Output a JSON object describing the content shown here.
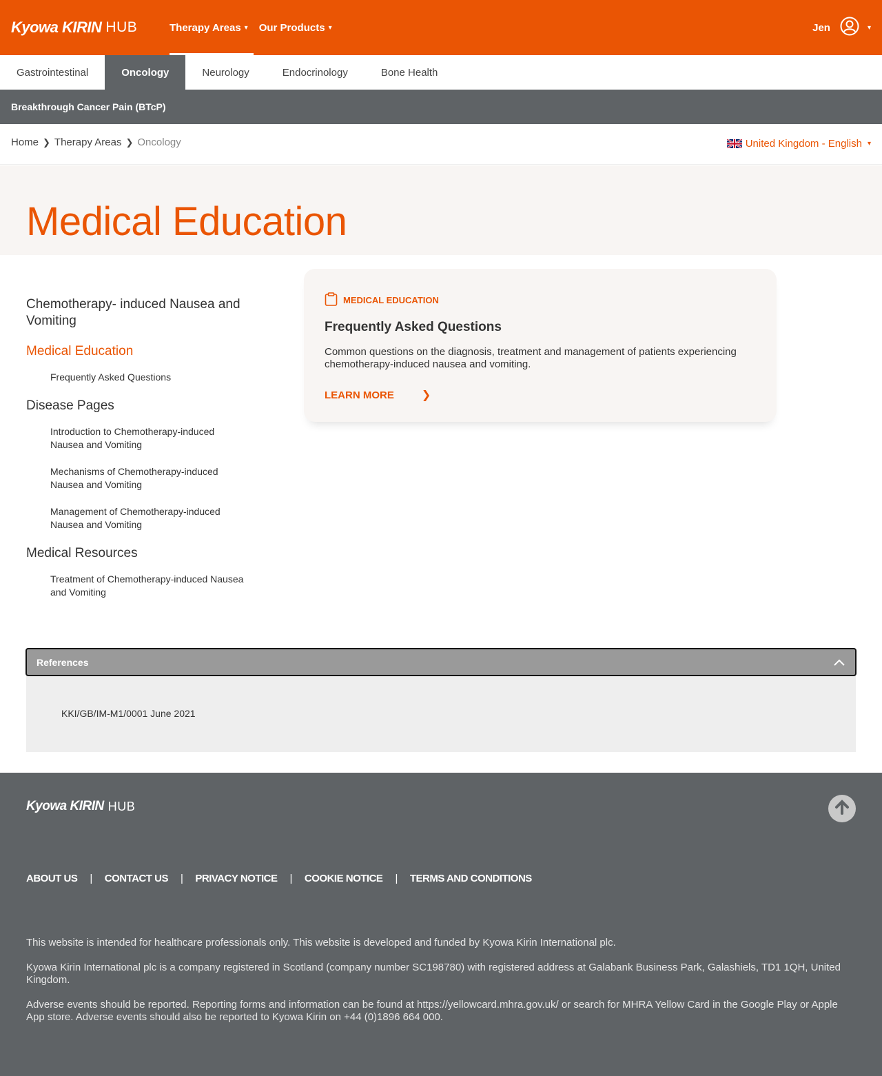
{
  "header": {
    "logo_mark": "Kyowa KIRIN",
    "logo_hub": "HUB",
    "nav": [
      {
        "label": "Therapy Areas",
        "caret": "▾"
      },
      {
        "label": "Our Products",
        "caret": "▾"
      }
    ],
    "user_name": "Jen",
    "user_caret": "▾"
  },
  "tabs": [
    "Gastrointestinal",
    "Oncology",
    "Neurology",
    "Endocrinology",
    "Bone Health"
  ],
  "subbar": {
    "label": "Breakthrough Cancer Pain (BTcP)"
  },
  "breadcrumb": {
    "items": [
      "Home",
      "Therapy Areas",
      "Oncology"
    ],
    "sep": "❯"
  },
  "language": {
    "label": "United Kingdom - English",
    "caret": "▾"
  },
  "hero": {
    "title": "Medical Education"
  },
  "sidebar": {
    "sections": [
      {
        "heading": "Chemotherapy- induced Nausea and Vomiting",
        "items": []
      },
      {
        "heading": "Medical Education",
        "items": [
          "Frequently Asked Questions"
        ]
      },
      {
        "heading": "Disease Pages",
        "items": [
          "Introduction to Chemotherapy-induced Nausea and Vomiting",
          "Mechanisms of Chemotherapy-induced Nausea and Vomiting",
          "Management of Chemotherapy-induced Nausea and Vomiting"
        ]
      },
      {
        "heading": "Medical Resources",
        "items": [
          "Treatment of Chemotherapy-induced Nausea and Vomiting"
        ]
      }
    ]
  },
  "card": {
    "label": "MEDICAL EDUCATION",
    "title": "Frequently Asked Questions",
    "description": "Common questions on the diagnosis, treatment and management of patients experiencing chemotherapy-induced nausea and vomiting.",
    "link": "LEARN MORE",
    "link_chevron": "❯"
  },
  "references": {
    "title": "References",
    "text": "KKI/GB/IM-M1/0001 June 2021"
  },
  "footer": {
    "logo_mark": "Kyowa KIRIN",
    "logo_hub": "HUB",
    "links": [
      "ABOUT US",
      "CONTACT US",
      "PRIVACY NOTICE",
      "COOKIE NOTICE",
      "TERMS AND CONDITIONS"
    ],
    "link_sep": "|",
    "legal": [
      "This website is intended for healthcare professionals only. This website is developed and funded by Kyowa Kirin International plc.",
      "Kyowa Kirin International plc is a company registered in Scotland (company number SC198780) with registered address at Galabank Business Park, Galashiels, TD1 1QH, United Kingdom.",
      "Adverse events should be reported. Reporting forms and information can be found at https://yellowcard.mhra.gov.uk/ or search for MHRA Yellow Card in the Google Play or Apple App store. Adverse events should also be reported to Kyowa Kirin on +44 (0)1896 664 000."
    ]
  },
  "colors": {
    "brand": "#ea5504",
    "dark": "#5f6366",
    "cream": "#f8f5f3"
  }
}
